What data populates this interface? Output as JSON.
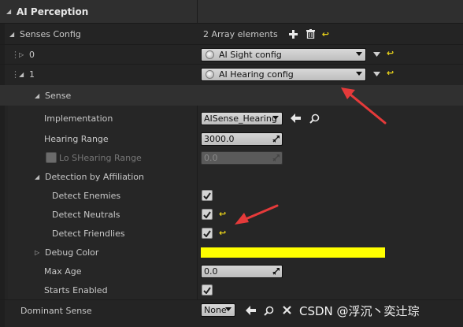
{
  "panel": {
    "title": "AI Perception"
  },
  "senses_config": {
    "label": "Senses Config",
    "count_text": "2 Array elements",
    "elements": [
      {
        "index": "0",
        "value": "AI Sight config"
      },
      {
        "index": "1",
        "value": "AI Hearing config"
      }
    ]
  },
  "sense": {
    "label": "Sense",
    "implementation": {
      "label": "Implementation",
      "value": "AISense_Hearing"
    },
    "hearing_range": {
      "label": "Hearing Range",
      "value": "3000.0"
    },
    "lo_shearing_range": {
      "label": "Lo SHearing Range",
      "value": "0.0"
    },
    "detection": {
      "label": "Detection by Affiliation",
      "enemies": {
        "label": "Detect Enemies",
        "checked": true
      },
      "neutrals": {
        "label": "Detect Neutrals",
        "checked": true
      },
      "friendlies": {
        "label": "Detect Friendlies",
        "checked": true
      }
    },
    "debug_color": {
      "label": "Debug Color",
      "color": "#ffff00"
    },
    "max_age": {
      "label": "Max Age",
      "value": "0.0"
    },
    "starts_enabled": {
      "label": "Starts Enabled",
      "checked": true
    }
  },
  "dominant_sense": {
    "label": "Dominant Sense",
    "value": "None"
  },
  "watermark": "CSDN @浮沉丶奕辻琮",
  "colors": {
    "annotation_red": "#e53a3a",
    "reset_yellow": "#e9d21a",
    "debug_yellow": "#ffff00"
  },
  "icons": [
    "add-icon",
    "trash-icon",
    "reset-arrow-icon",
    "browse-arrow-icon",
    "search-icon",
    "clear-icon",
    "dropdown-icon"
  ]
}
